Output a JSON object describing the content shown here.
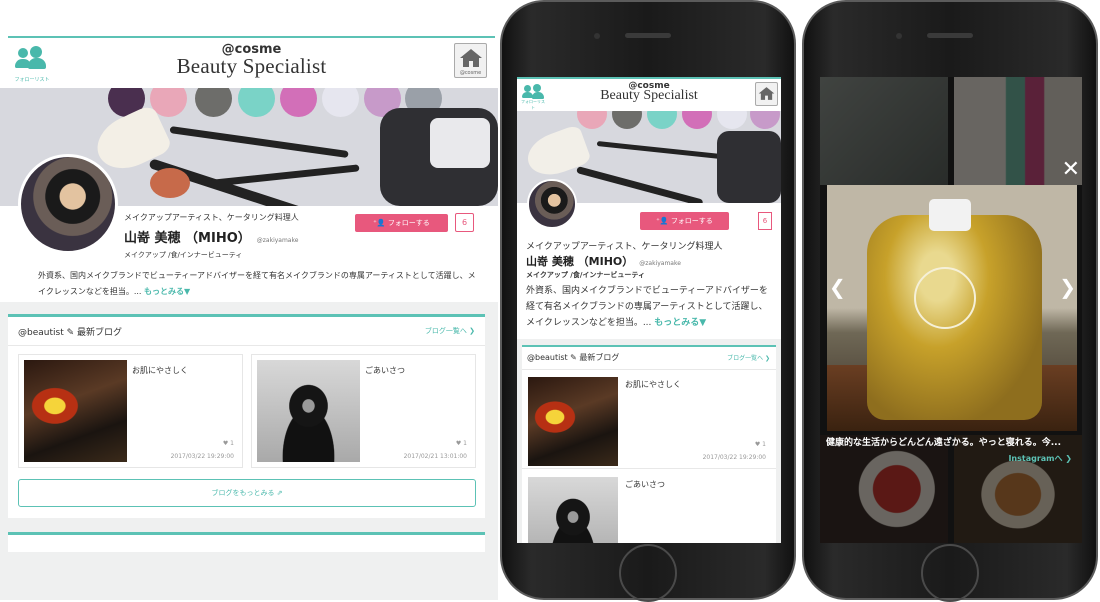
{
  "header": {
    "brand_top": "@cosme",
    "brand_main": "Beauty Specialist",
    "follow_list_label": "フォローリスト",
    "home_label": "@cosme"
  },
  "profile": {
    "role": "メイクアップアーティスト、ケータリング料理人",
    "name": "山嵜 美穂 （MIHO）",
    "handle": "@zakiyamake",
    "category": "メイクアップ /食/インナービューティ",
    "bio": "外資系、国内メイクブランドでビューティーアドバイザーを経て有名メイクブランドの専属アーティストとして活躍し、メイクレッスンなどを担当。...",
    "more_label": "もっとみる▼",
    "follow_button": "フォローする",
    "follower_count": "6"
  },
  "blog": {
    "title": "@beautist ✎ 最新ブログ",
    "list_link": "ブログ一覧へ ❯",
    "posts": [
      {
        "title": "お肌にやさしく",
        "likes": "♥ 1",
        "date": "2017/03/22 19:29:00"
      },
      {
        "title": "ごあいさつ",
        "likes": "♥ 1",
        "date": "2017/02/21 13:01:00"
      }
    ],
    "more_button": "ブログをもっとみる ⇗"
  },
  "instagram": {
    "caption": "健康的な生活からどんどん遠ざかる。やっと寝れる。今...",
    "link": "Instagramへ ❯",
    "close": "✕",
    "prev": "❮",
    "next": "❯"
  }
}
